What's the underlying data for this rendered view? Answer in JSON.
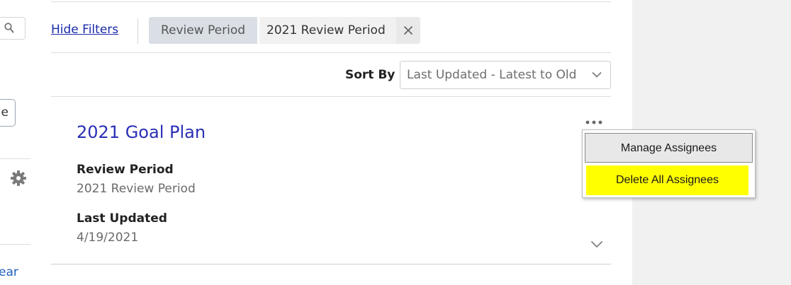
{
  "filters": {
    "hide_filters_label": "Hide Filters",
    "chip": {
      "label": "Review Period",
      "value": "2021 Review Period"
    }
  },
  "sort": {
    "label": "Sort By",
    "selected": "Last Updated - Latest to Old"
  },
  "left_column": {
    "clipped_button_text": "e",
    "clipped_link_text": "ear"
  },
  "card": {
    "title": "2021 Goal Plan",
    "fields": [
      {
        "label": "Review Period",
        "value": "2021 Review Period"
      },
      {
        "label": "Last Updated",
        "value": "4/19/2021"
      }
    ]
  },
  "menu": {
    "items": [
      {
        "label": "Manage Assignees"
      },
      {
        "label": "Delete All Assignees",
        "highlight": "#ffff00"
      }
    ]
  },
  "colors": {
    "link": "#1a2aa8",
    "title": "#2a2fb5",
    "chip_bg": "#d9dfe5",
    "highlight": "#ffff00",
    "right_pane": "#f1f1f1"
  },
  "icons": [
    "search-icon",
    "gear-icon",
    "close-icon",
    "chevron-down-icon",
    "ellipsis-icon"
  ]
}
